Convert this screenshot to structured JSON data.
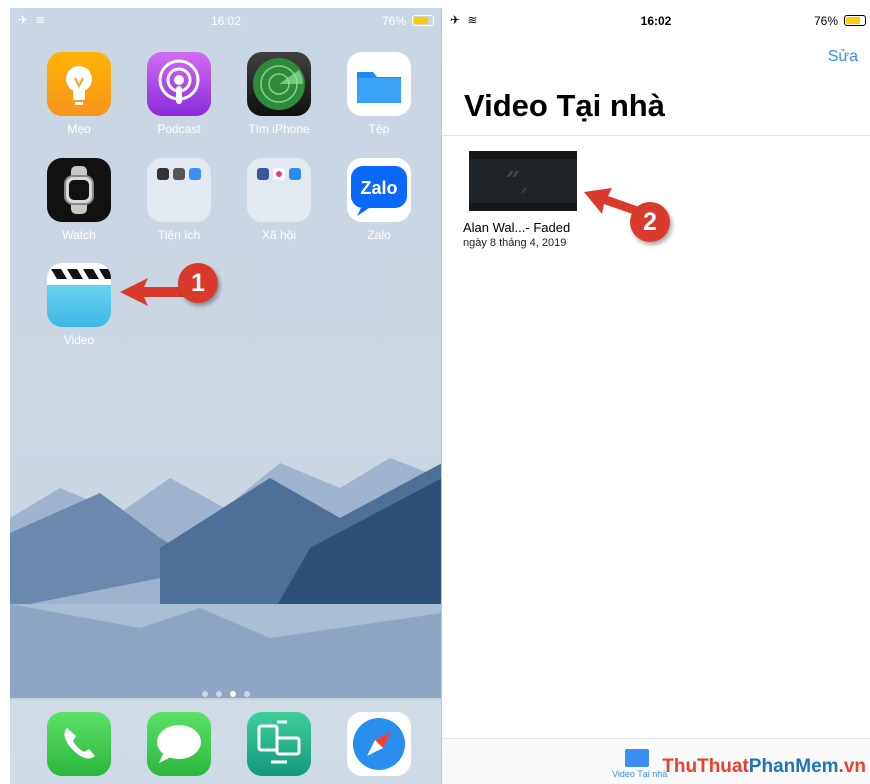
{
  "home": {
    "status": {
      "time": "16:02",
      "battery": "76%"
    },
    "apps": [
      {
        "label": "Mẹo"
      },
      {
        "label": "Podcast"
      },
      {
        "label": "Tìm iPhone"
      },
      {
        "label": "Tệp"
      },
      {
        "label": "Watch"
      },
      {
        "label": "Tiện ích"
      },
      {
        "label": "Xã hội"
      },
      {
        "label": "Zalo"
      },
      {
        "label": "Video"
      }
    ],
    "page_dots": 4,
    "active_page": 3
  },
  "videos": {
    "status": {
      "time": "16:02",
      "battery": "76%"
    },
    "edit_label": "Sửa",
    "title": "Video Tại nhà",
    "items": [
      {
        "name": "Alan Wal...- Faded",
        "date": "ngày 8 tháng 4, 2019"
      }
    ],
    "tab_label": "Video Tại nhà"
  },
  "callouts": {
    "one": "1",
    "two": "2"
  },
  "watermark": {
    "part1": "ThuThuat",
    "part2": "PhanMem",
    "part3": ".vn"
  },
  "colors": {
    "accent_blue": "#3a8ef6",
    "callout_red": "#d93a2b",
    "battery_yellow": "#ffcc00"
  }
}
